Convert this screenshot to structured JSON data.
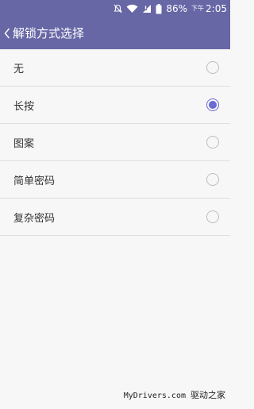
{
  "status_bar": {
    "battery_percent": "86%",
    "time_period": "下午",
    "time": "2:05",
    "icons": [
      "do-not-disturb-icon",
      "wifi-icon",
      "signal-icon",
      "battery-icon"
    ]
  },
  "header": {
    "title": "解锁方式选择",
    "back_icon": "chevron-left-icon"
  },
  "options": [
    {
      "label": "无",
      "selected": false
    },
    {
      "label": "长按",
      "selected": true
    },
    {
      "label": "图案",
      "selected": false
    },
    {
      "label": "简单密码",
      "selected": false
    },
    {
      "label": "复杂密码",
      "selected": false
    }
  ],
  "watermark": {
    "site": "MyDrivers.com",
    "brand": "驱动之家"
  },
  "colors": {
    "header_bg": "#6767a6",
    "accent": "#6b6bd6",
    "background": "#f7f7f7",
    "divider": "#dedede"
  }
}
